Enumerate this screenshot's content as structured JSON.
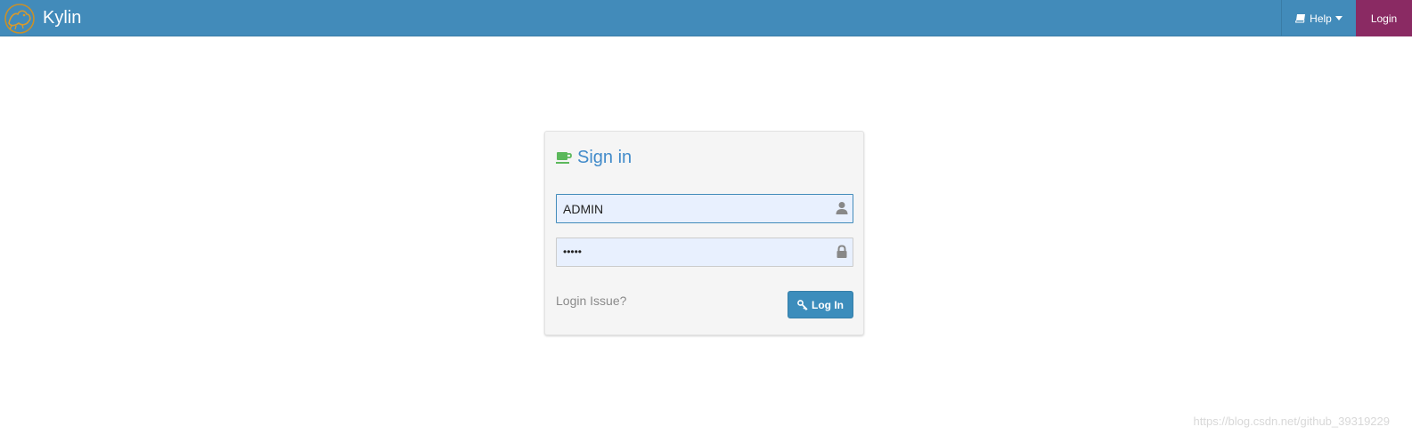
{
  "navbar": {
    "brand_name": "Kylin",
    "logo_icon": "kylin-logo-icon",
    "help_label": "Help",
    "login_label": "Login",
    "colors": {
      "bar": "#428bba",
      "login_bg": "#8a2a63"
    }
  },
  "signin": {
    "title": "Sign in",
    "title_icon": "coffee-cup-icon",
    "username": {
      "value": "ADMIN",
      "icon": "user-icon"
    },
    "password": {
      "masked_value": "•••••",
      "icon": "lock-icon"
    },
    "login_issue_link": "Login Issue?",
    "submit_label": "Log In",
    "submit_icon": "key-icon",
    "colors": {
      "title": "#428bca",
      "button": "#3c8dbc",
      "cup": "#5cb85c"
    }
  },
  "watermark": "https://blog.csdn.net/github_39319229"
}
